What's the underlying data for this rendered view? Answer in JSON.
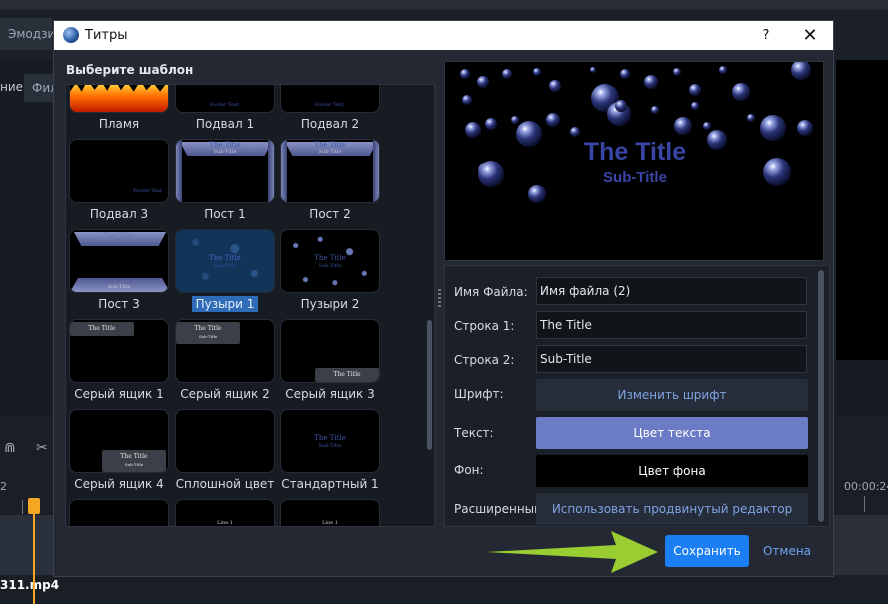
{
  "background": {
    "tab_emoji": "Эмодзи",
    "left_fragment": "ние",
    "filter_fragment": "Фил",
    "time_left": "2",
    "time_right": "00:00:24",
    "clip_name": "311.mp4",
    "icons": [
      "magnet-icon",
      "scissors-icon"
    ]
  },
  "dialog": {
    "title": "Титры",
    "help_label": "?",
    "close_label": "✕",
    "heading": "Выберите шаблон",
    "templates": [
      {
        "label": "Пламя",
        "style": "flame"
      },
      {
        "label": "Подвал 1",
        "style": "footer"
      },
      {
        "label": "Подвал 2",
        "style": "footer"
      },
      {
        "label": "Подвал 3",
        "style": "footer3"
      },
      {
        "label": "Пост 1",
        "style": "post"
      },
      {
        "label": "Пост 2",
        "style": "post"
      },
      {
        "label": "Пост 3",
        "style": "post3"
      },
      {
        "label": "Пузыри 1",
        "style": "bubbles",
        "selected": true
      },
      {
        "label": "Пузыри 2",
        "style": "dots"
      },
      {
        "label": "Серый ящик 1",
        "style": "gray1"
      },
      {
        "label": "Серый ящик 2",
        "style": "gray2"
      },
      {
        "label": "Серый ящик 3",
        "style": "gray3"
      },
      {
        "label": "Серый ящик 4",
        "style": "gray4"
      },
      {
        "label": "Сплошной цвет",
        "style": "solid"
      },
      {
        "label": "Стандартный 1",
        "style": "standard"
      },
      {
        "label": "",
        "style": "blank"
      },
      {
        "label": "",
        "style": "line"
      },
      {
        "label": "",
        "style": "line"
      }
    ],
    "thumb_text": {
      "title": "The Title",
      "subtitle": "Sub-Title",
      "footer": "Footer Text",
      "line": "Line 1"
    },
    "preview": {
      "title": "The Title",
      "subtitle": "Sub-Title",
      "background": "#000000",
      "text_color": "#3a46a6"
    },
    "form": {
      "filename_label": "Имя Файла:",
      "filename_value": "Имя файла (2)",
      "line1_label": "Строка 1:",
      "line1_value": "The Title",
      "line2_label": "Строка 2:",
      "line2_value": "Sub-Title",
      "font_label": "Шрифт:",
      "font_button": "Изменить шрифт",
      "text_label": "Текст:",
      "text_button": "Цвет текста",
      "bg_label": "Фон:",
      "bg_button": "Цвет фона",
      "advanced_label": "Расширенный:",
      "advanced_button": "Использовать продвинутый редактор"
    },
    "save_label": "Сохранить",
    "cancel_label": "Отмена",
    "colors": {
      "accent": "#1b7ef2",
      "text_button": "#6b7bc6",
      "arrow": "#9acd32"
    }
  }
}
